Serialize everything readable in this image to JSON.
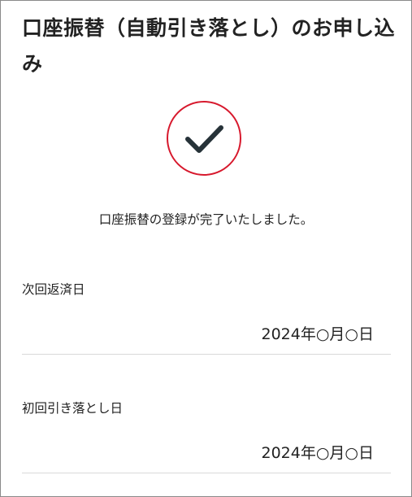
{
  "header": {
    "title": "口座振替（自動引き落とし）のお申し込み"
  },
  "status": {
    "icon": "check-icon",
    "ring_color": "#d7192d",
    "check_color": "#263238",
    "message": "口座振替の登録が完了いたしました。"
  },
  "details": {
    "next_repayment_date": {
      "label": "次回返済日",
      "value": "2024年○月○日"
    },
    "first_debit_date": {
      "label": "初回引き落とし日",
      "value": "2024年○月○日"
    }
  }
}
